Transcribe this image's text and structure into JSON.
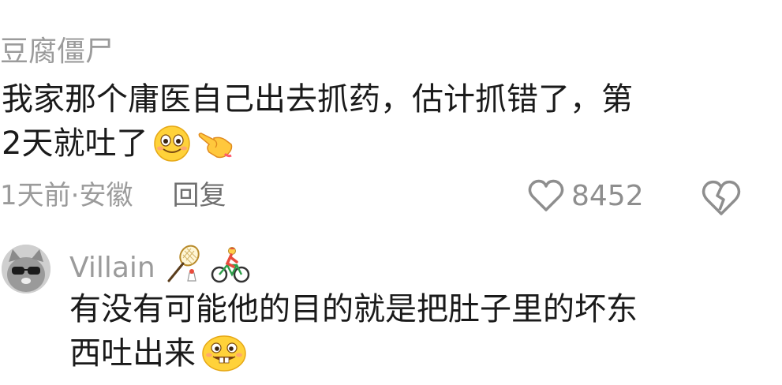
{
  "comments": [
    {
      "username": "豆腐僵尸",
      "lines": [
        "我家那个庸医自己出去抓药，估计抓错了，第",
        "2天就吐了"
      ],
      "emojis": [
        "grinning-smile-emoji",
        "pointing-hand-emoji"
      ],
      "time_location": "1天前·安徽",
      "reply_label": "回复",
      "likes": "8452"
    },
    {
      "username": "Villain",
      "badges": [
        "badminton-icon",
        "cyclist-icon"
      ],
      "lines": [
        "有没有可能他的目的就是把肚子里的坏东",
        "西吐出来"
      ],
      "emojis": [
        "buck-tooth-grin-emoji"
      ]
    }
  ],
  "colors": {
    "text": "#1a1a1a",
    "muted": "#9b9b9b",
    "emoji_yellow": "#ffd23a"
  }
}
